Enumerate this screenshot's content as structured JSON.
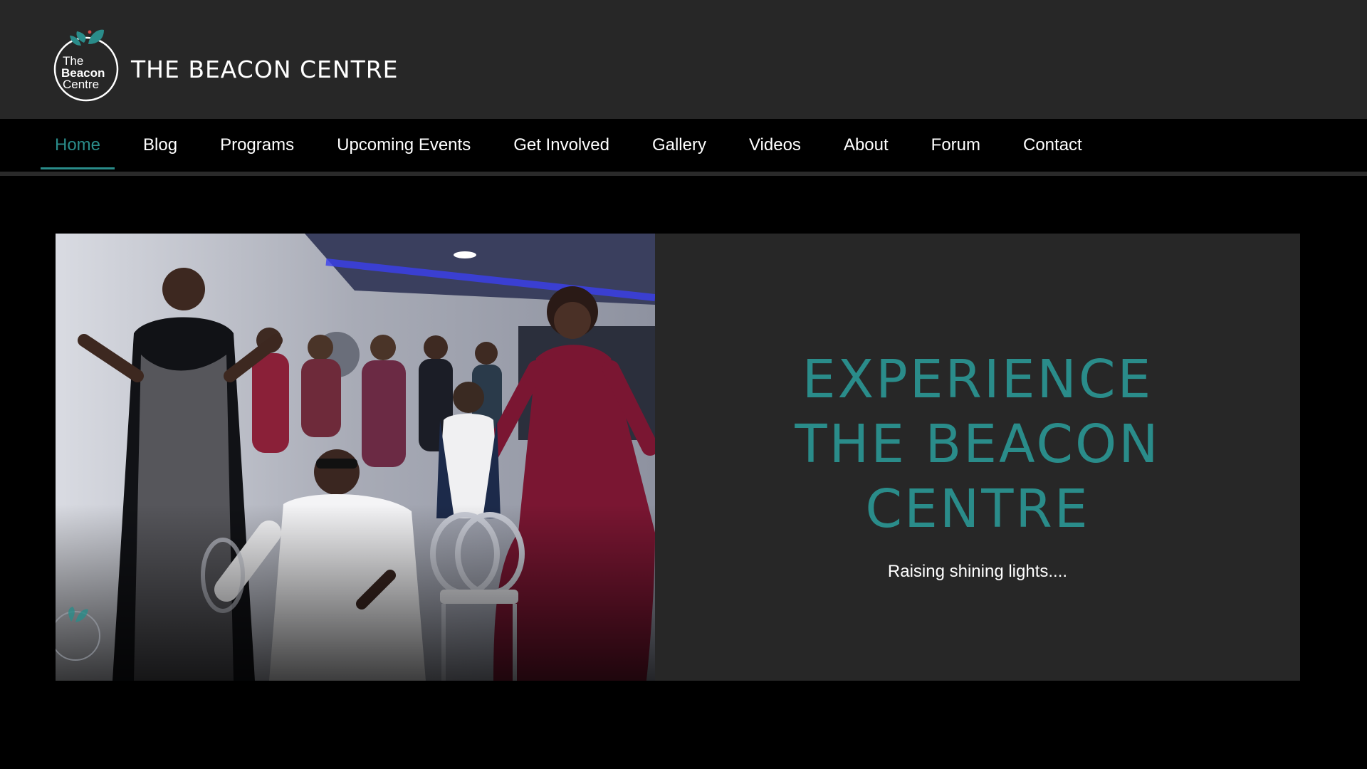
{
  "brand": {
    "logo_line1": "The",
    "logo_line2": "Beacon",
    "logo_line3": "Centre",
    "site_title": "THE BEACON CENTRE"
  },
  "nav": {
    "items": [
      {
        "label": "Home",
        "active": true
      },
      {
        "label": "Blog"
      },
      {
        "label": "Programs"
      },
      {
        "label": "Upcoming Events"
      },
      {
        "label": "Get Involved"
      },
      {
        "label": "Gallery"
      },
      {
        "label": "Videos"
      },
      {
        "label": "About"
      },
      {
        "label": "Forum"
      },
      {
        "label": "Contact"
      }
    ]
  },
  "hero": {
    "heading": "EXPERIENCE THE BEACON CENTRE",
    "tagline": "Raising shining lights...."
  },
  "colors": {
    "accent": "#2a8c8a",
    "header_bg": "#272727",
    "nav_bg": "#000000",
    "panel_bg": "#272727"
  }
}
